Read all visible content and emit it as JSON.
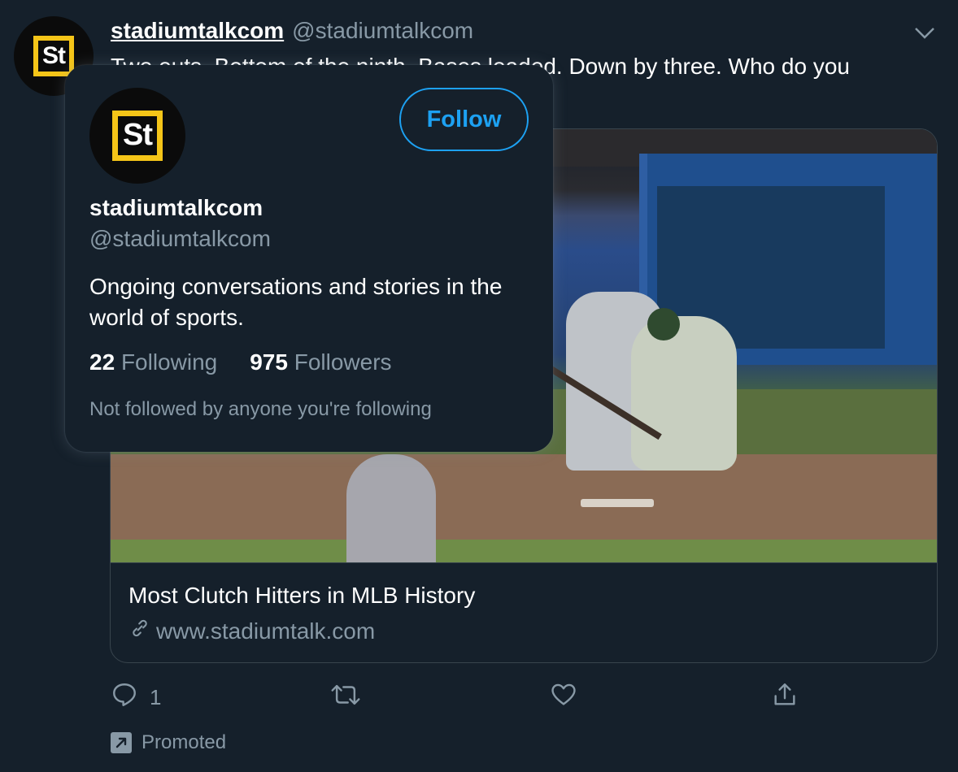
{
  "tweet": {
    "display_name": "stadiumtalkcom",
    "handle": "@stadiumtalkcom",
    "avatar_text": "St",
    "text": "Two outs. Bottom of the ninth. Bases loaded. Down by three. Who do you"
  },
  "card": {
    "title": "Most Clutch Hitters in MLB History",
    "link": "www.stadiumtalk.com"
  },
  "actions": {
    "reply_count": "1",
    "retweet_count": "",
    "like_count": ""
  },
  "promoted_label": "Promoted",
  "hovercard": {
    "avatar_text": "St",
    "follow_label": "Follow",
    "name": "stadiumtalkcom",
    "handle": "@stadiumtalkcom",
    "bio": "Ongoing conversations and stories in the world of sports.",
    "following_count": "22",
    "following_label": "Following",
    "followers_count": "975",
    "followers_label": "Followers",
    "note": "Not followed by anyone you're following"
  },
  "colors": {
    "background": "#15202b",
    "accent": "#1da1f2",
    "secondary_text": "#8899a6",
    "logo_frame": "#f5c518",
    "border": "#38444d"
  },
  "icons": {
    "caret": "chevron-down-icon",
    "reply": "reply-icon",
    "retweet": "retweet-icon",
    "like": "heart-icon",
    "share": "share-icon",
    "link": "link-icon",
    "promoted": "promoted-icon"
  }
}
